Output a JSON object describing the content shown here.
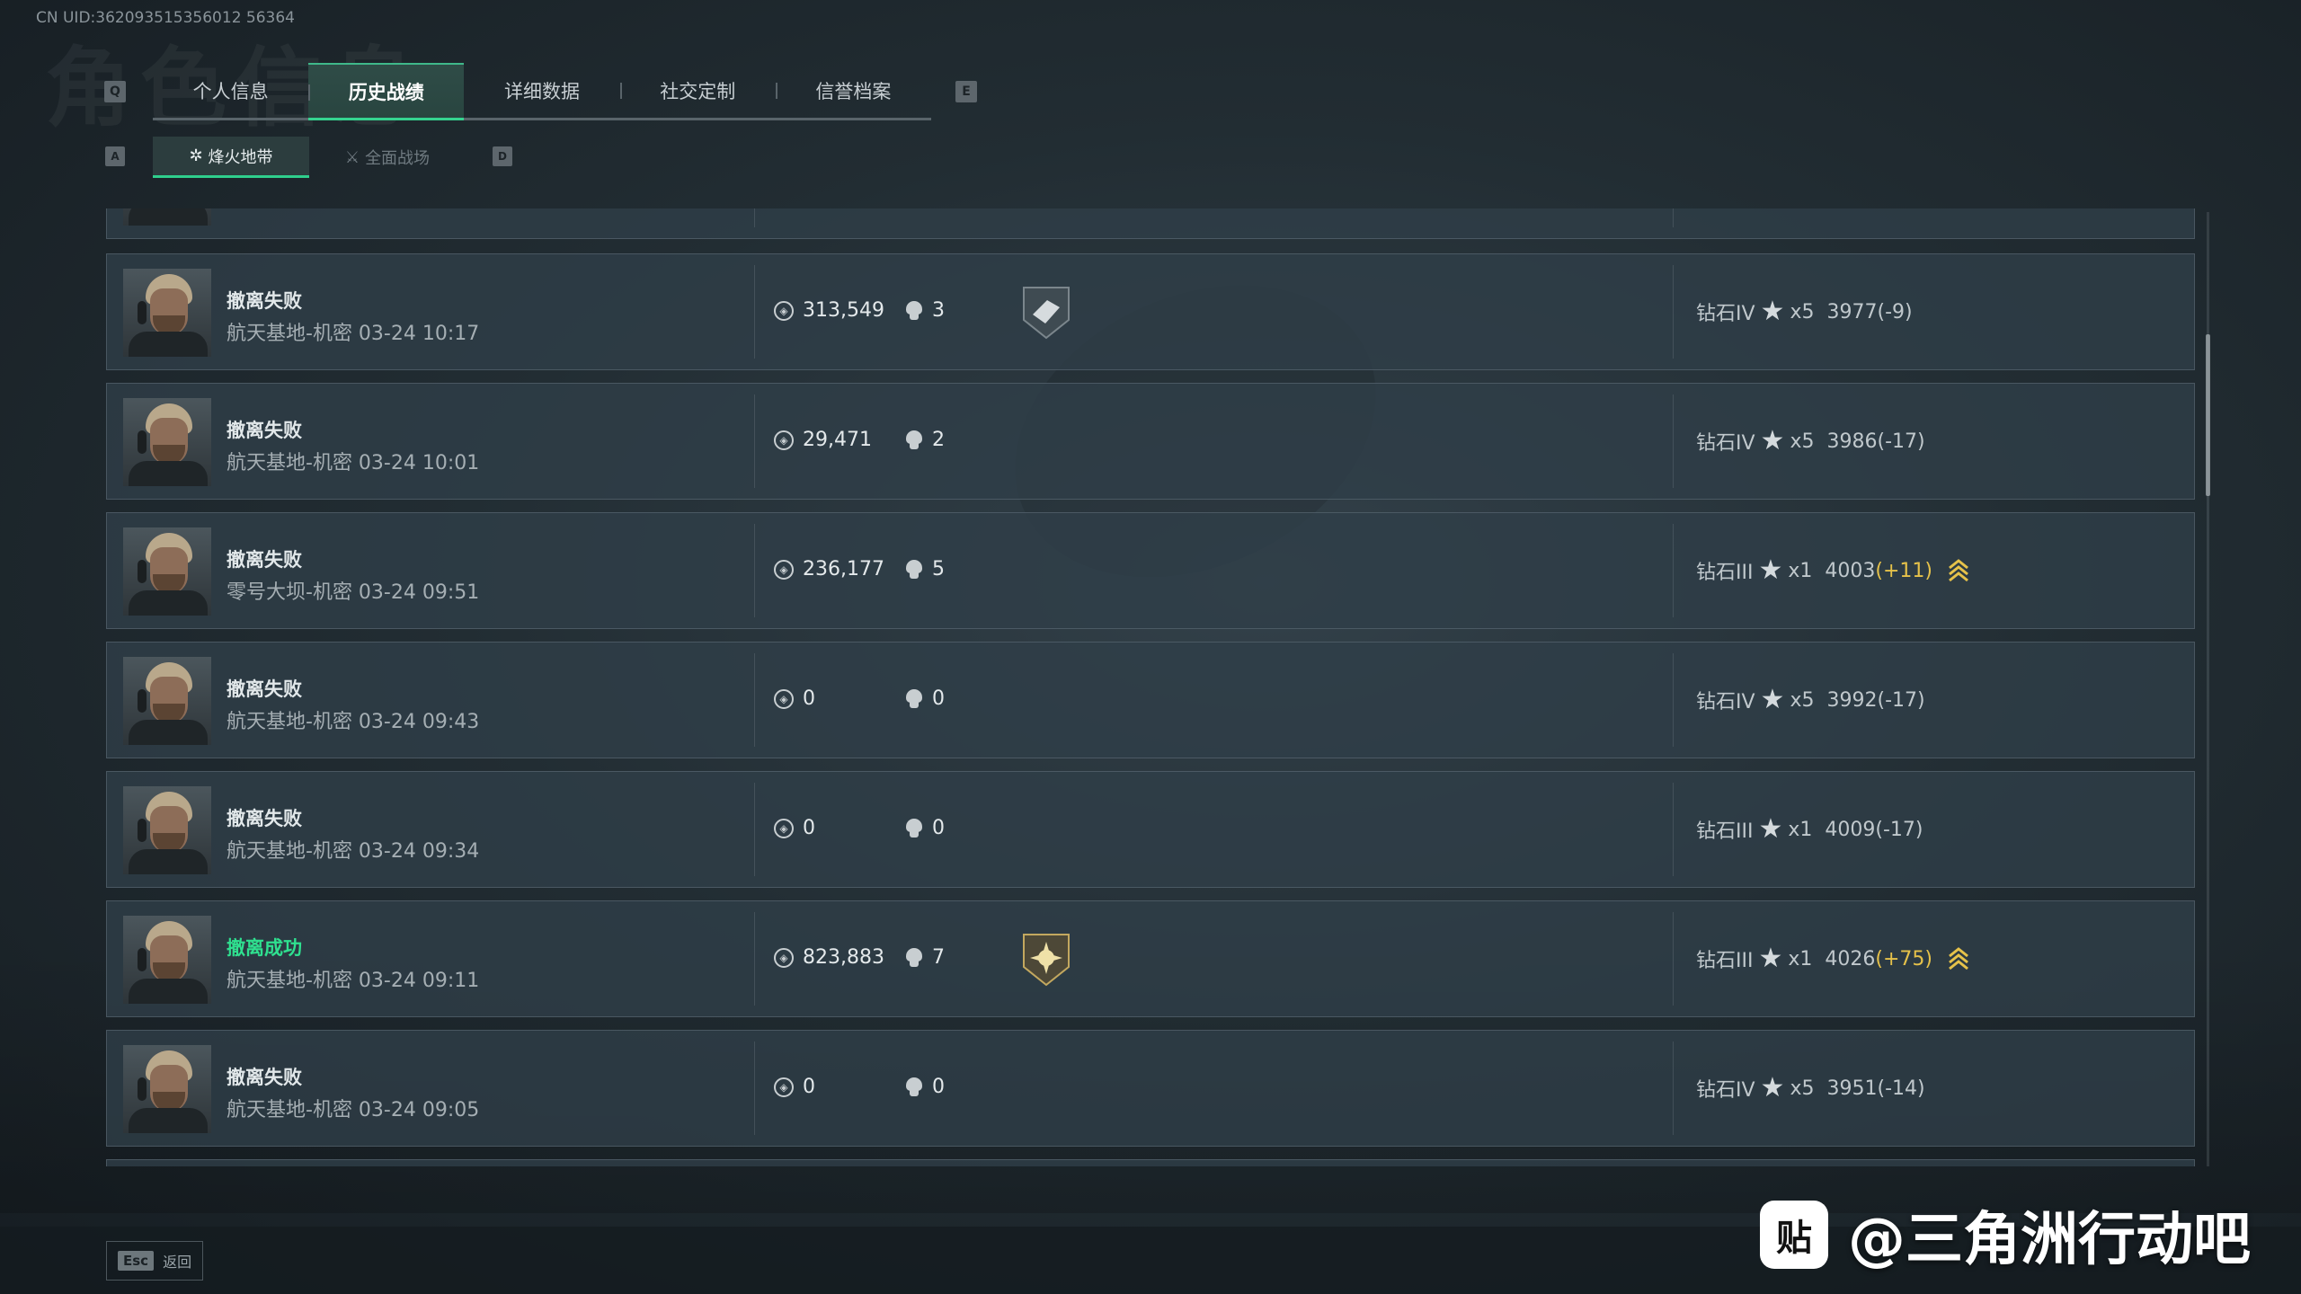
{
  "uid": "CN UID:362093515356012 56364",
  "top_tabs": {
    "left_key": "Q",
    "right_key": "E",
    "items": [
      "个人信息",
      "历史战绩",
      "详细数据",
      "社交定制",
      "信誉档案"
    ]
  },
  "sub_tabs": {
    "left_key": "A",
    "right_key": "D",
    "items": [
      "烽火地带",
      "全面战场"
    ]
  },
  "matches": [
    {
      "result": "撤离失败",
      "success": false,
      "map": "航天基地-机密 03-24 10:17",
      "value": "313,549",
      "kills": "3",
      "badge": "shield-badge",
      "rank": "钻石IV",
      "stars": "x5",
      "score": "3977",
      "delta": "(-9)",
      "up": false
    },
    {
      "result": "撤离失败",
      "success": false,
      "map": "航天基地-机密 03-24 10:01",
      "value": "29,471",
      "kills": "2",
      "badge": "",
      "rank": "钻石IV",
      "stars": "x5",
      "score": "3986",
      "delta": "(-17)",
      "up": false
    },
    {
      "result": "撤离失败",
      "success": false,
      "map": "零号大坝-机密 03-24 09:51",
      "value": "236,177",
      "kills": "5",
      "badge": "",
      "rank": "钻石III",
      "stars": "x1",
      "score": "4003",
      "delta": "(+11)",
      "up": true
    },
    {
      "result": "撤离失败",
      "success": false,
      "map": "航天基地-机密 03-24 09:43",
      "value": "0",
      "kills": "0",
      "badge": "",
      "rank": "钻石IV",
      "stars": "x5",
      "score": "3992",
      "delta": "(-17)",
      "up": false
    },
    {
      "result": "撤离失败",
      "success": false,
      "map": "航天基地-机密 03-24 09:34",
      "value": "0",
      "kills": "0",
      "badge": "",
      "rank": "钻石III",
      "stars": "x1",
      "score": "4009",
      "delta": "(-17)",
      "up": false
    },
    {
      "result": "撤离成功",
      "success": true,
      "map": "航天基地-机密 03-24 09:11",
      "value": "823,883",
      "kills": "7",
      "badge": "sun-badge",
      "rank": "钻石III",
      "stars": "x1",
      "score": "4026",
      "delta": "(+75)",
      "up": true
    },
    {
      "result": "撤离失败",
      "success": false,
      "map": "航天基地-机密 03-24 09:05",
      "value": "0",
      "kills": "0",
      "badge": "",
      "rank": "钻石IV",
      "stars": "x5",
      "score": "3951",
      "delta": "(-14)",
      "up": false
    }
  ],
  "footer": {
    "esc_key": "Esc",
    "back_label": "返回"
  },
  "watermark": {
    "icon_text": "贴",
    "text": "@三角洲行动吧"
  },
  "colors": {
    "accent_green": "#2fe08f",
    "rank_up_gold": "#e6c24a",
    "row_bg": "#303e48"
  }
}
